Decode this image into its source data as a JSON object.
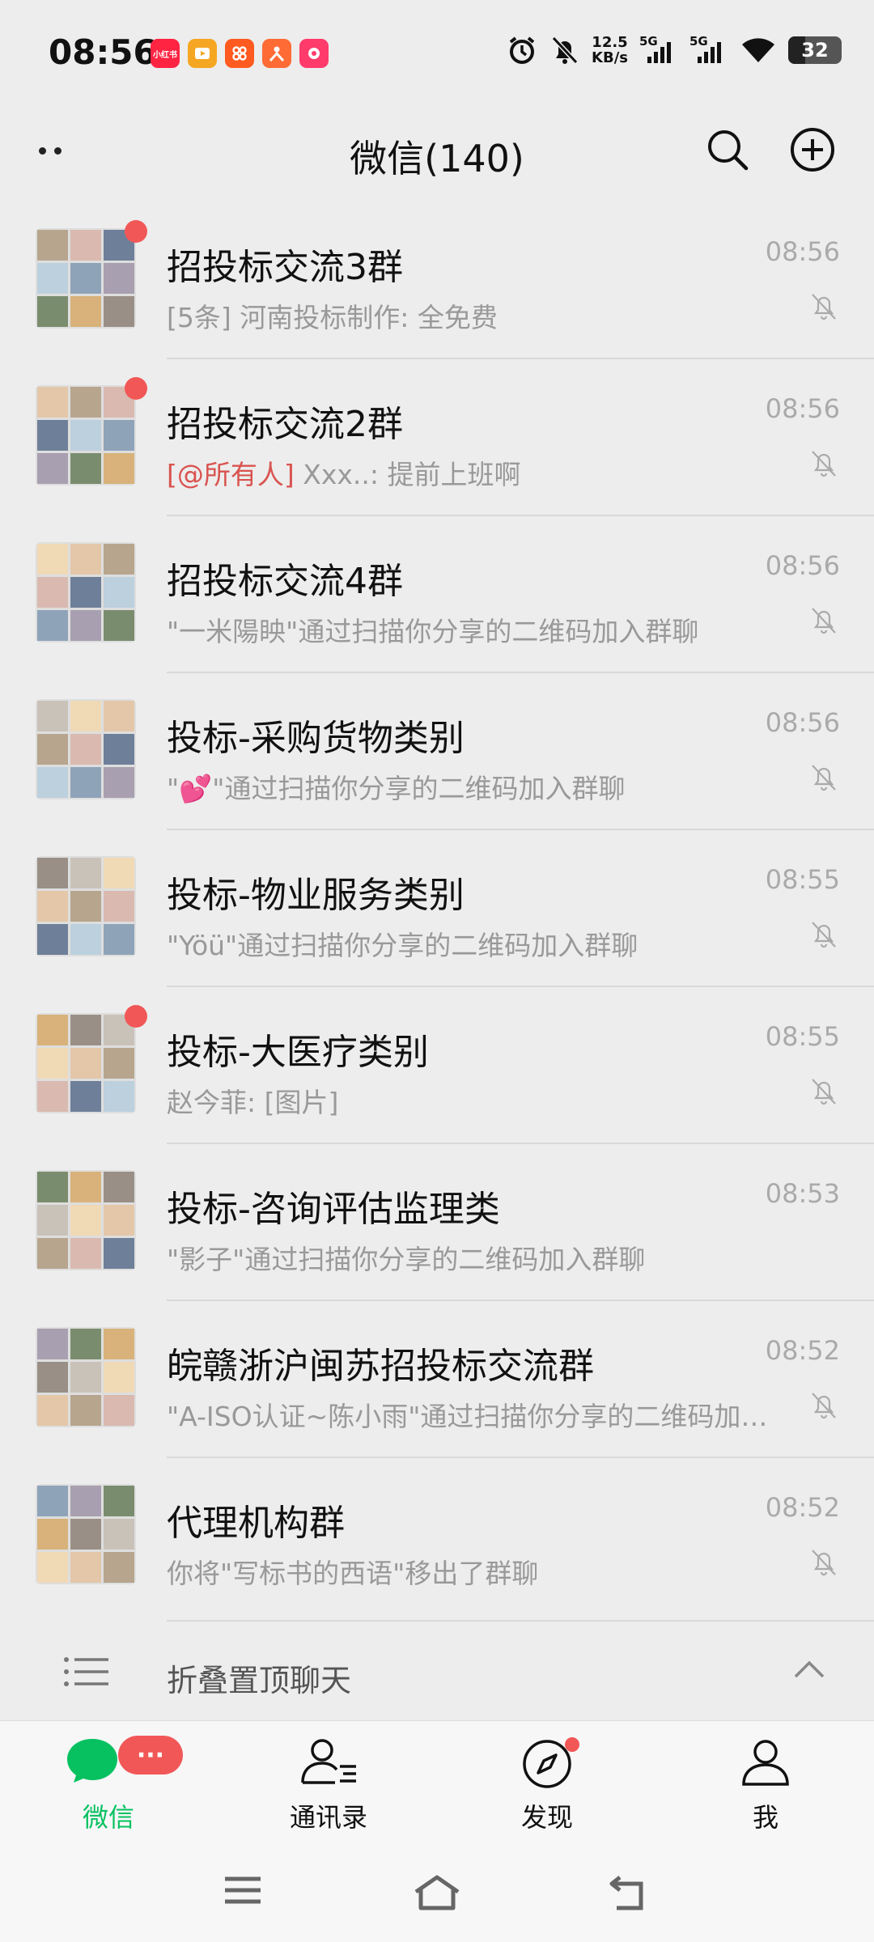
{
  "status_bar": {
    "time": "08:56",
    "net_speed_value": "12.5",
    "net_speed_unit": "KB/s",
    "sim1": "5G",
    "sim2": "5G",
    "battery": "32",
    "battery_level": 0.32,
    "app_icons": [
      {
        "name": "xiaohongshu-icon",
        "label": "小红书",
        "color": "#ff2442"
      },
      {
        "name": "video-app-icon",
        "color": "#f5a623"
      },
      {
        "name": "grid-app-icon",
        "color": "#ff5a1f"
      },
      {
        "name": "person-app-icon",
        "color": "#ff6b35"
      },
      {
        "name": "game-app-icon",
        "color": "#ff3b6b"
      }
    ]
  },
  "header": {
    "title": "微信(140)"
  },
  "chats": [
    {
      "name": "招投标交流3群",
      "preview": "[5条] 河南投标制作: 全免费",
      "time": "08:56",
      "unread_dot": true
    },
    {
      "name": "招投标交流2群",
      "mention": "[@所有人]",
      "preview": " Xxx..: 提前上班啊",
      "time": "08:56",
      "unread_dot": true
    },
    {
      "name": "招投标交流4群",
      "preview": "\"一米陽眏\"通过扫描你分享的二维码加入群聊",
      "time": "08:56",
      "unread_dot": false
    },
    {
      "name": "投标-采购货物类别",
      "preview": "\"💕\"通过扫描你分享的二维码加入群聊",
      "time": "08:56",
      "unread_dot": false
    },
    {
      "name": "投标-物业服务类别",
      "preview": "\"Yöü\"通过扫描你分享的二维码加入群聊",
      "time": "08:55",
      "unread_dot": false
    },
    {
      "name": "投标-大医疗类别",
      "preview": "赵今菲: [图片]",
      "time": "08:55",
      "unread_dot": true
    },
    {
      "name": "投标-咨询评估监理类",
      "preview": "\"影子\"通过扫描你分享的二维码加入群聊",
      "time": "08:53",
      "unread_dot": false
    },
    {
      "name": "皖赣浙沪闽苏招投标交流群",
      "preview": "\"A-ISO认证~陈小雨\"通过扫描你分享的二维码加入群聊",
      "time": "08:52",
      "unread_dot": false
    },
    {
      "name": "代理机构群",
      "preview": "你将\"写标书的西语\"移出了群聊",
      "time": "08:52",
      "unread_dot": false
    }
  ],
  "fold": {
    "label": "折叠置顶聊天"
  },
  "tabs": [
    {
      "label": "微信",
      "badge": "···"
    },
    {
      "label": "通讯录"
    },
    {
      "label": "发现"
    },
    {
      "label": "我"
    }
  ],
  "colors": {
    "accent": "#07c160",
    "badge": "#f25757",
    "background": "#ededed"
  }
}
